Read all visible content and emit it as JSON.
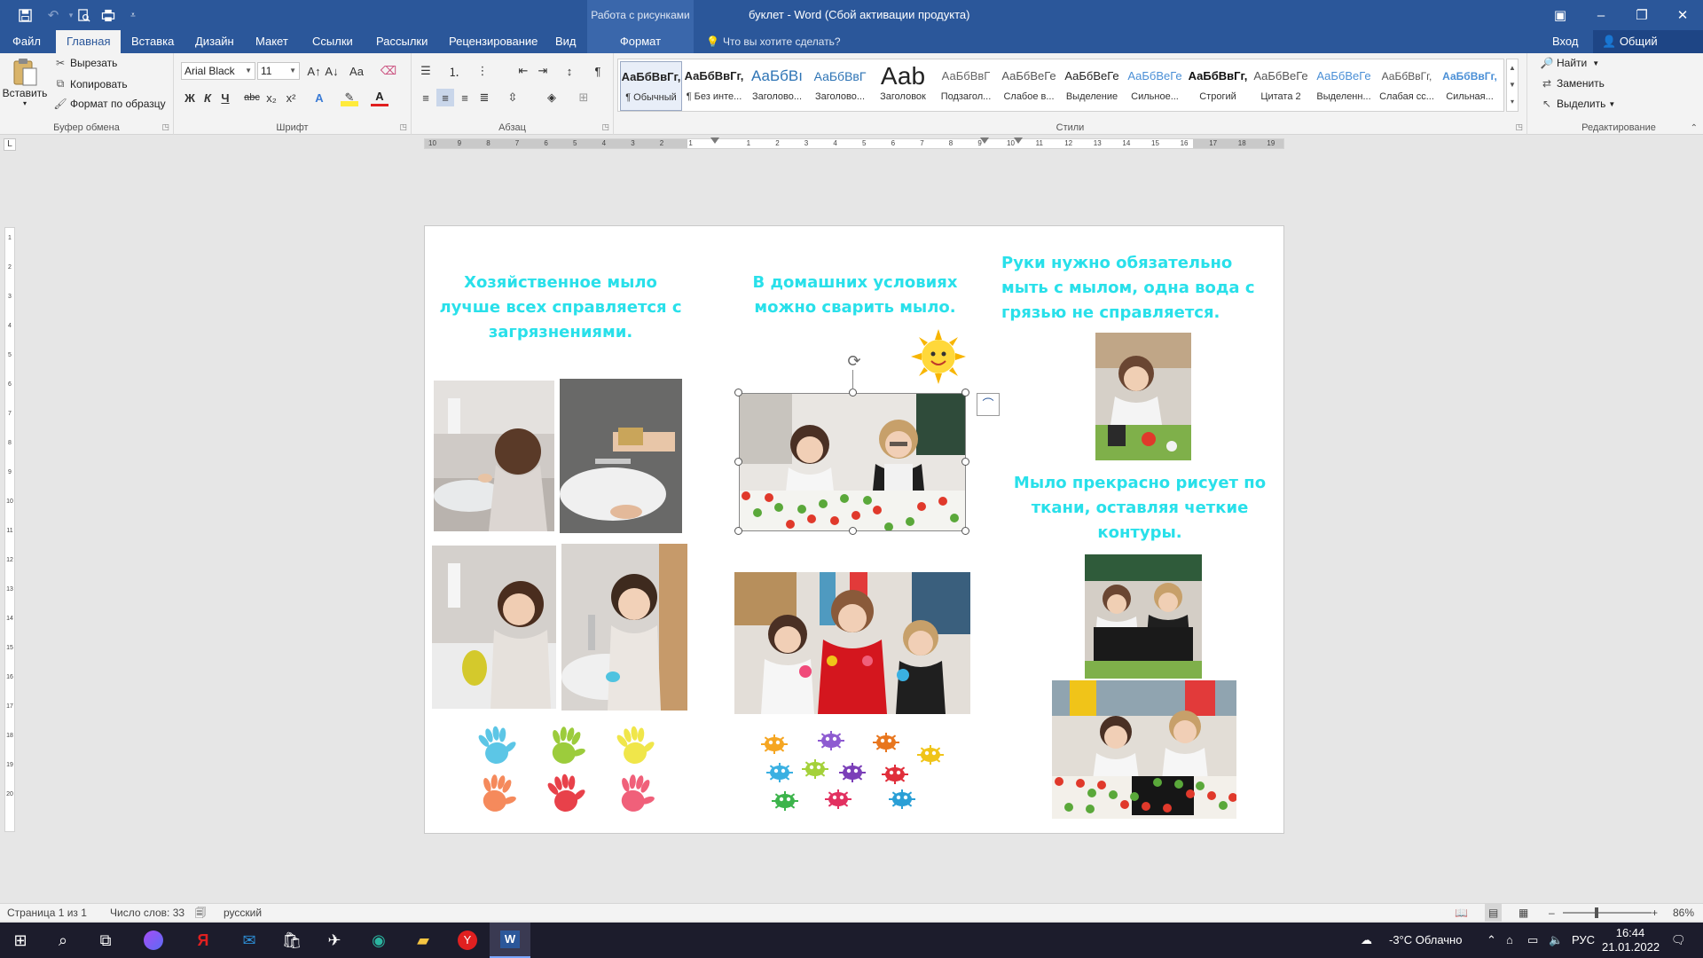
{
  "titlebar": {
    "context_group": "Работа с рисунками",
    "doc_title": "буклет - Word (Сбой активации продукта)",
    "quick_access": [
      "save-icon",
      "undo-icon",
      "redo-icon",
      "print-preview-icon",
      "customize-icon"
    ],
    "window_icons": {
      "ribbon_display": "▣",
      "minimize": "–",
      "restore": "❐",
      "close": "✕"
    }
  },
  "tabs": [
    {
      "label": "Файл",
      "key": "file"
    },
    {
      "label": "Главная",
      "key": "home",
      "active": true
    },
    {
      "label": "Вставка",
      "key": "insert"
    },
    {
      "label": "Дизайн",
      "key": "design"
    },
    {
      "label": "Макет",
      "key": "layout"
    },
    {
      "label": "Ссылки",
      "key": "references"
    },
    {
      "label": "Рассылки",
      "key": "mailings"
    },
    {
      "label": "Рецензирование",
      "key": "review"
    },
    {
      "label": "Вид",
      "key": "view"
    },
    {
      "label": "Формат",
      "key": "format"
    }
  ],
  "tellme": "Что вы хотите сделать?",
  "signin": "Вход",
  "share": "Общий доступ",
  "clipboard": {
    "label": "Буфер обмена",
    "paste": "Вставить",
    "cut": "Вырезать",
    "copy": "Копировать",
    "format_painter": "Формат по образцу"
  },
  "font": {
    "label": "Шрифт",
    "name": "Arial Black",
    "size": "11",
    "bold": "Ж",
    "italic": "К",
    "underline": "Ч",
    "strike": "abc",
    "subscript": "x₂",
    "superscript": "x²",
    "case": "Аа",
    "grow": "A↑",
    "shrink": "A↓"
  },
  "paragraph": {
    "label": "Абзац"
  },
  "styles": {
    "label": "Стили",
    "items": [
      {
        "sample": "АаБбВвГг,",
        "name": "¶ Обычный",
        "color": "#222222",
        "size": "13px",
        "weight": "bold",
        "selected": true
      },
      {
        "sample": "АаБбВвГг,",
        "name": "¶ Без инте...",
        "color": "#222222",
        "size": "13px",
        "weight": "bold"
      },
      {
        "sample": "АаБбВı",
        "name": "Заголово...",
        "color": "#2e74b5",
        "size": "17px",
        "weight": "normal"
      },
      {
        "sample": "АаБбВвГ",
        "name": "Заголово...",
        "color": "#2e74b5",
        "size": "14px",
        "weight": "normal"
      },
      {
        "sample": "Ааb",
        "name": "Заголовок",
        "color": "#222222",
        "size": "28px",
        "weight": "normal"
      },
      {
        "sample": "АаБбВвГ",
        "name": "Подзагол...",
        "color": "#666666",
        "size": "13px",
        "weight": "normal"
      },
      {
        "sample": "АаБбВеГе",
        "name": "Слабое в...",
        "color": "#555555",
        "size": "13px",
        "weight": "normal"
      },
      {
        "sample": "АаБбВеГе",
        "name": "Выделение",
        "color": "#222222",
        "size": "13px",
        "weight": "normal"
      },
      {
        "sample": "АаБбВеГе",
        "name": "Сильное...",
        "color": "#4a8fd6",
        "size": "13px",
        "weight": "normal"
      },
      {
        "sample": "АаБбВвГг,",
        "name": "Строгий",
        "color": "#111111",
        "size": "13px",
        "weight": "bold"
      },
      {
        "sample": "АаБбВеГе",
        "name": "Цитата 2",
        "color": "#555555",
        "size": "13px",
        "weight": "normal"
      },
      {
        "sample": "АаБбВеГе",
        "name": "Выделенн...",
        "color": "#4a8fd6",
        "size": "13px",
        "weight": "normal"
      },
      {
        "sample": "АаБбВвГг,",
        "name": "Слабая сс...",
        "color": "#555555",
        "size": "12px",
        "weight": "normal"
      },
      {
        "sample": "АаБбВвГг,",
        "name": "Сильная...",
        "color": "#4a8fd6",
        "size": "12px",
        "weight": "bold"
      }
    ]
  },
  "editing": {
    "label": "Редактирование",
    "find": "Найти",
    "replace": "Заменить",
    "select": "Выделить"
  },
  "ruler": {
    "h_ticks": [
      "10",
      "9",
      "8",
      "7",
      "6",
      "5",
      "4",
      "3",
      "2",
      "1",
      "",
      "1",
      "2",
      "3",
      "4",
      "5",
      "6",
      "7",
      "8",
      "9",
      "10",
      "11",
      "12",
      "13",
      "14",
      "15",
      "16",
      "17",
      "18",
      "19"
    ],
    "v_ticks": [
      "1",
      "2",
      "3",
      "4",
      "5",
      "6",
      "7",
      "8",
      "9",
      "10",
      "11",
      "12",
      "13",
      "14",
      "15",
      "16",
      "17",
      "18",
      "19",
      "20"
    ]
  },
  "document": {
    "col1_heading": "Хозяйственное мыло лучше всех справляется с загрязнениями.",
    "col2_heading": "В домашних условиях можно сварить мыло.",
    "col3_heading_top": "Руки нужно обязательно мыть с мылом, одна вода с грязью не справляется.",
    "col3_heading_mid": "Мыло прекрасно рисует по ткани, оставляя четкие контуры.",
    "hand_colors": [
      "#5cc6e6",
      "#9ccc3c",
      "#f0e64a",
      "#f58a5c",
      "#e8414a",
      "#f0607a"
    ],
    "germ_colors": [
      "#f5a623",
      "#8e5bd1",
      "#e8761e",
      "#f0c419",
      "#3ab0e2",
      "#a4d13a",
      "#7b3fb8",
      "#e02e3a",
      "#3cb44b",
      "#e23060",
      "#2a9fd6"
    ]
  },
  "status": {
    "page": "Страница 1 из 1",
    "words": "Число слов: 33",
    "lang": "русский",
    "zoom": "86%"
  },
  "taskbar": {
    "weather": "-3°C  Облачно",
    "lang": "РУС",
    "time": "16:44",
    "date": "21.01.2022"
  }
}
